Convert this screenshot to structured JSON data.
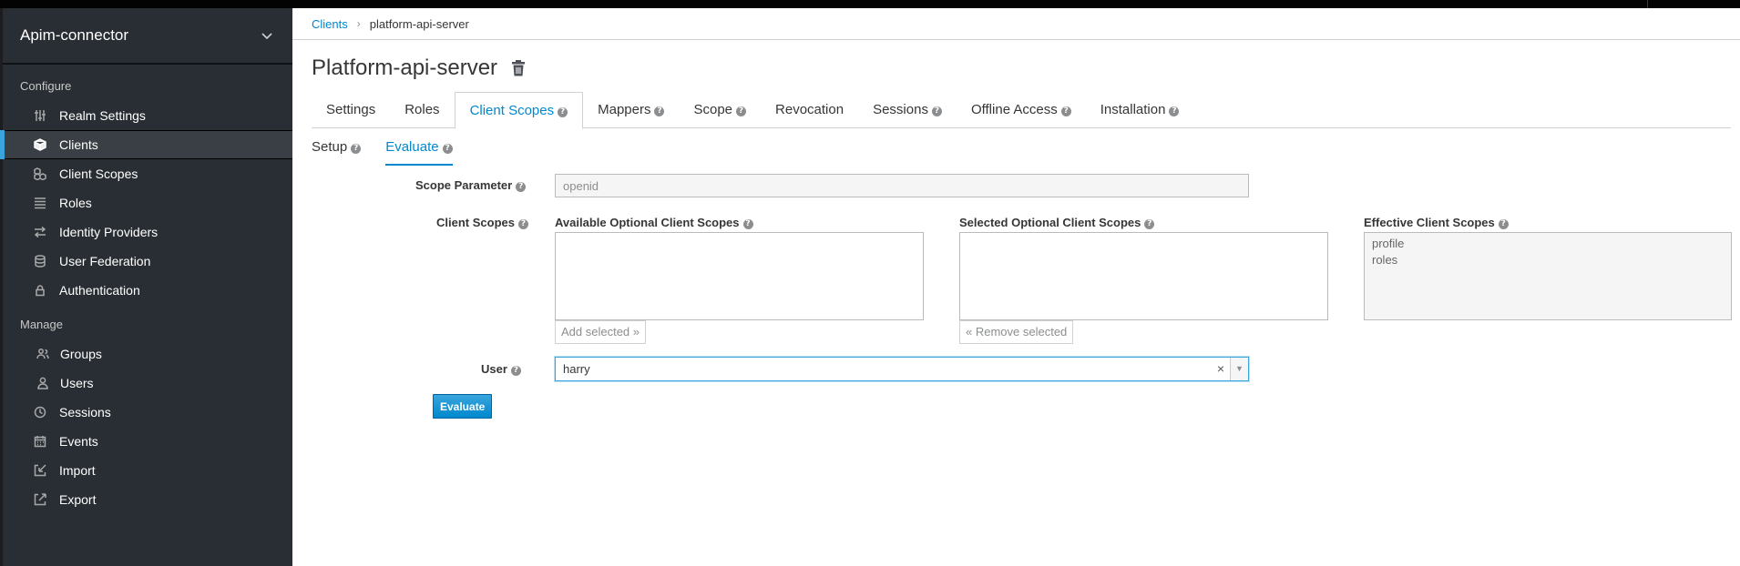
{
  "sidebar": {
    "realm_name": "Apim-connector",
    "configure_label": "Configure",
    "manage_label": "Manage",
    "configure_items": [
      {
        "label": "Realm Settings",
        "icon": "sliders-icon"
      },
      {
        "label": "Clients",
        "icon": "cube-icon"
      },
      {
        "label": "Client Scopes",
        "icon": "cubes-icon"
      },
      {
        "label": "Roles",
        "icon": "list-icon"
      },
      {
        "label": "Identity Providers",
        "icon": "exchange-icon"
      },
      {
        "label": "User Federation",
        "icon": "database-icon"
      },
      {
        "label": "Authentication",
        "icon": "lock-icon"
      }
    ],
    "manage_items": [
      {
        "label": "Groups",
        "icon": "users-icon"
      },
      {
        "label": "Users",
        "icon": "user-icon"
      },
      {
        "label": "Sessions",
        "icon": "clock-icon"
      },
      {
        "label": "Events",
        "icon": "calendar-icon"
      },
      {
        "label": "Import",
        "icon": "import-icon"
      },
      {
        "label": "Export",
        "icon": "export-icon"
      }
    ],
    "active_item": "Clients"
  },
  "breadcrumb": {
    "parent": "Clients",
    "current": "platform-api-server"
  },
  "page": {
    "title": "Platform-api-server"
  },
  "tabs": [
    {
      "label": "Settings",
      "help": false
    },
    {
      "label": "Roles",
      "help": false
    },
    {
      "label": "Client Scopes",
      "help": true
    },
    {
      "label": "Mappers",
      "help": true
    },
    {
      "label": "Scope",
      "help": true
    },
    {
      "label": "Revocation",
      "help": false
    },
    {
      "label": "Sessions",
      "help": true
    },
    {
      "label": "Offline Access",
      "help": true
    },
    {
      "label": "Installation",
      "help": true
    }
  ],
  "active_tab": "Client Scopes",
  "subtabs": [
    {
      "label": "Setup"
    },
    {
      "label": "Evaluate"
    }
  ],
  "active_subtab": "Evaluate",
  "form": {
    "scope_parameter_label": "Scope Parameter",
    "scope_parameter_value": "openid",
    "client_scopes_label": "Client Scopes",
    "available_title": "Available Optional Client Scopes",
    "selected_title": "Selected Optional Client Scopes",
    "effective_title": "Effective Client Scopes",
    "effective_scopes": [
      "profile",
      "roles"
    ],
    "add_selected_label": "Add selected »",
    "remove_selected_label": "« Remove selected",
    "user_label": "User",
    "user_value": "harry",
    "clear_glyph": "×",
    "caret_glyph": "▼",
    "evaluate_label": "Evaluate"
  },
  "colors": {
    "accent": "#0088ce",
    "sidebar_bg": "#292e34",
    "active_marker": "#39a5dc"
  }
}
